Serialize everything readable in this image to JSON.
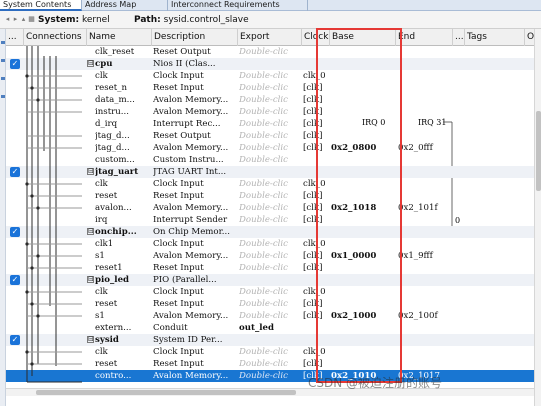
{
  "tabs": [
    "System Contents",
    "Address Map",
    "Interconnect Requirements"
  ],
  "toolbar": {
    "system_label": "System:",
    "system_value": "kernel",
    "path_label": "Path:",
    "path_value": "sysid.control_slave"
  },
  "columns": {
    "use": "...",
    "connections": "Connections",
    "name": "Name",
    "description": "Description",
    "export": "Export",
    "clock": "Clock",
    "base": "Base",
    "end": "End",
    "irq": "...",
    "tags": "Tags",
    "opcode": "O"
  },
  "irq_labels": {
    "irq0": "IRQ 0",
    "irq31": "IRQ 31"
  },
  "irq_number": "0",
  "rows": [
    {
      "kind": "iface",
      "name": "clk_reset",
      "desc": "Reset Output",
      "export": "Double-clic",
      "clock": "",
      "base": "",
      "end": ""
    },
    {
      "kind": "group",
      "checked": true,
      "expander": "⊟",
      "name": "cpu",
      "desc": "Nios II (Clas...",
      "export": "",
      "clock": "",
      "base": "",
      "end": ""
    },
    {
      "kind": "iface",
      "name": "clk",
      "desc": "Clock Input",
      "export": "Double-clic",
      "clock": "clk_0",
      "base": "",
      "end": ""
    },
    {
      "kind": "iface",
      "name": "reset_n",
      "desc": "Reset Input",
      "export": "Double-clic",
      "clock": "[clk]",
      "base": "",
      "end": ""
    },
    {
      "kind": "iface",
      "name": "data_m...",
      "desc": "Avalon Memory...",
      "export": "Double-clic",
      "clock": "[clk]",
      "base": "",
      "end": ""
    },
    {
      "kind": "iface",
      "name": "instru...",
      "desc": "Avalon Memory...",
      "export": "Double-clic",
      "clock": "[clk]",
      "base": "",
      "end": ""
    },
    {
      "kind": "iface",
      "name": "d_irq",
      "desc": "Interrupt Rec...",
      "export": "Double-clic",
      "clock": "[clk]",
      "base": "",
      "end": ""
    },
    {
      "kind": "iface",
      "name": "jtag_d...",
      "desc": "Reset Output",
      "export": "Double-clic",
      "clock": "[clk]",
      "base": "",
      "end": ""
    },
    {
      "kind": "iface",
      "name": "jtag_d...",
      "desc": "Avalon Memory...",
      "export": "Double-clic",
      "clock": "[clk]",
      "base": "0x2_0800",
      "end": "0x2_0fff"
    },
    {
      "kind": "iface",
      "name": "custom...",
      "desc": "Custom Instru...",
      "export": "Double-clic",
      "clock": "",
      "base": "",
      "end": ""
    },
    {
      "kind": "group",
      "checked": true,
      "expander": "⊟",
      "name": "jtag_uart",
      "desc": "JTAG UART Int...",
      "export": "",
      "clock": "",
      "base": "",
      "end": ""
    },
    {
      "kind": "iface",
      "name": "clk",
      "desc": "Clock Input",
      "export": "Double-clic",
      "clock": "clk_0",
      "base": "",
      "end": ""
    },
    {
      "kind": "iface",
      "name": "reset",
      "desc": "Reset Input",
      "export": "Double-clic",
      "clock": "[clk]",
      "base": "",
      "end": ""
    },
    {
      "kind": "iface",
      "name": "avalon...",
      "desc": "Avalon Memory...",
      "export": "Double-clic",
      "clock": "[clk]",
      "base": "0x2_1018",
      "end": "0x2_101f"
    },
    {
      "kind": "iface",
      "name": "irq",
      "desc": "Interrupt Sender",
      "export": "Double-clic",
      "clock": "[clk]",
      "base": "",
      "end": ""
    },
    {
      "kind": "group",
      "checked": true,
      "expander": "⊟",
      "name": "onchip...",
      "desc": "On Chip Memor...",
      "export": "",
      "clock": "",
      "base": "",
      "end": ""
    },
    {
      "kind": "iface",
      "name": "clk1",
      "desc": "Clock Input",
      "export": "Double-clic",
      "clock": "clk_0",
      "base": "",
      "end": ""
    },
    {
      "kind": "iface",
      "name": "s1",
      "desc": "Avalon Memory...",
      "export": "Double-clic",
      "clock": "[clk]",
      "base": "0x1_0000",
      "end": "0x1_9fff"
    },
    {
      "kind": "iface",
      "name": "reset1",
      "desc": "Reset Input",
      "export": "Double-clic",
      "clock": "[clk]",
      "base": "",
      "end": ""
    },
    {
      "kind": "group",
      "checked": true,
      "expander": "⊟",
      "name": "pio_led",
      "desc": "PIO (Parallel...",
      "export": "",
      "clock": "",
      "base": "",
      "end": ""
    },
    {
      "kind": "iface",
      "name": "clk",
      "desc": "Clock Input",
      "export": "Double-clic",
      "clock": "clk_0",
      "base": "",
      "end": ""
    },
    {
      "kind": "iface",
      "name": "reset",
      "desc": "Reset Input",
      "export": "Double-clic",
      "clock": "[clk]",
      "base": "",
      "end": ""
    },
    {
      "kind": "iface",
      "name": "s1",
      "desc": "Avalon Memory...",
      "export": "Double-clic",
      "clock": "[clk]",
      "base": "0x2_1000",
      "end": "0x2_100f"
    },
    {
      "kind": "iface",
      "name": "extern...",
      "desc": "Conduit",
      "export": "out_led",
      "exportSolid": true,
      "clock": "",
      "base": "",
      "end": ""
    },
    {
      "kind": "group",
      "checked": true,
      "expander": "⊟",
      "name": "sysid",
      "desc": "System ID Per...",
      "export": "",
      "clock": "",
      "base": "",
      "end": ""
    },
    {
      "kind": "iface",
      "name": "clk",
      "desc": "Clock Input",
      "export": "Double-clic",
      "clock": "clk_0",
      "base": "",
      "end": ""
    },
    {
      "kind": "iface",
      "name": "reset",
      "desc": "Reset Input",
      "export": "Double-clic",
      "clock": "[clk]",
      "base": "",
      "end": ""
    },
    {
      "kind": "sel",
      "name": "contro...",
      "desc": "Avalon Memory...",
      "export": "Double-clic",
      "clock": "[clk]",
      "base": "0x2_1010",
      "end": "0x2_1017"
    }
  ],
  "watermark": "CSDN @被迫注册的账号",
  "colors": {
    "selection": "#1976d2",
    "checkbox": "#1a73d9",
    "highlight_box": "#e53935"
  }
}
